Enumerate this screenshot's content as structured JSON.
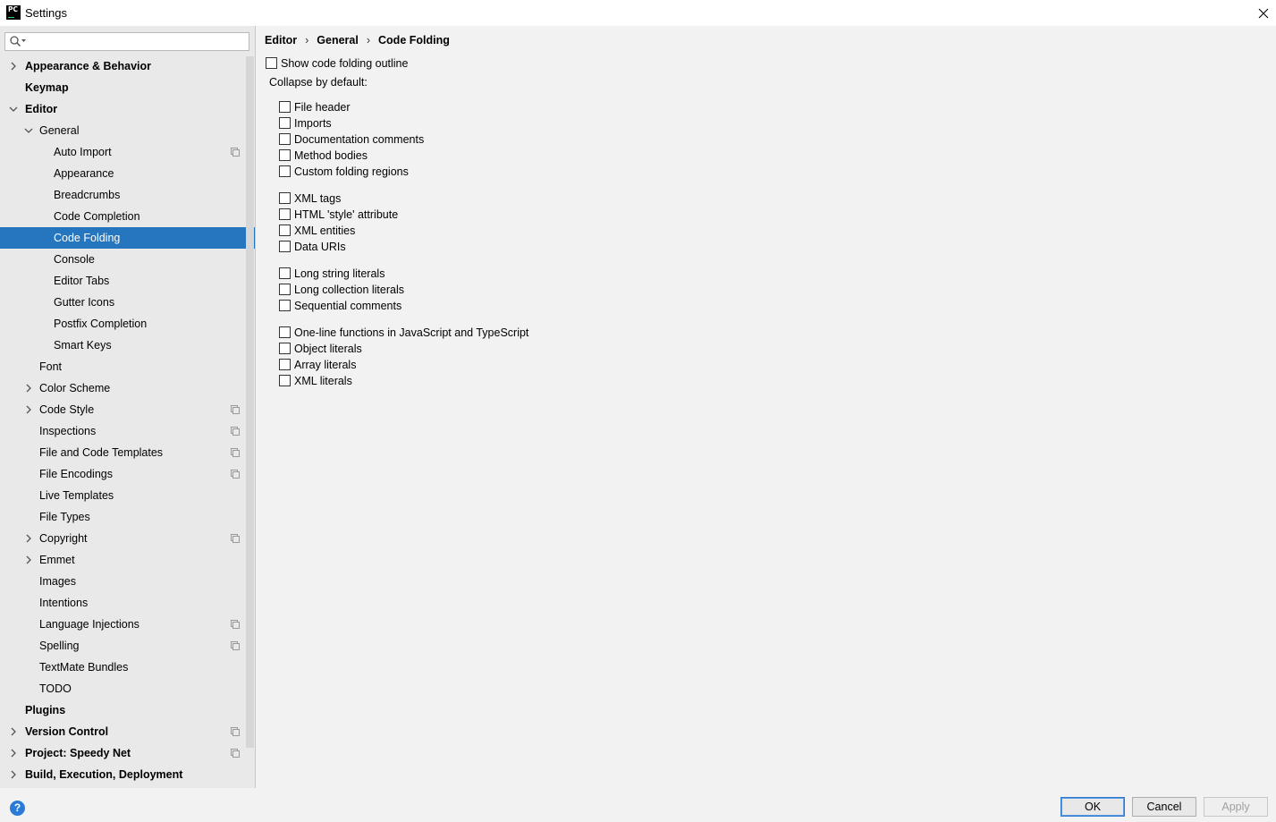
{
  "window": {
    "title": "Settings",
    "app_icon_text": "PC"
  },
  "sidebar": {
    "search_placeholder": "",
    "items": [
      {
        "label": "Appearance & Behavior",
        "level": 0,
        "bold": true,
        "arrow": "right",
        "project": false,
        "selected": false
      },
      {
        "label": "Keymap",
        "level": 0,
        "bold": true,
        "arrow": "none",
        "project": false,
        "selected": false
      },
      {
        "label": "Editor",
        "level": 0,
        "bold": true,
        "arrow": "down",
        "project": false,
        "selected": false
      },
      {
        "label": "General",
        "level": 1,
        "bold": false,
        "arrow": "down",
        "project": false,
        "selected": false
      },
      {
        "label": "Auto Import",
        "level": 2,
        "bold": false,
        "arrow": "none",
        "project": true,
        "selected": false
      },
      {
        "label": "Appearance",
        "level": 2,
        "bold": false,
        "arrow": "none",
        "project": false,
        "selected": false
      },
      {
        "label": "Breadcrumbs",
        "level": 2,
        "bold": false,
        "arrow": "none",
        "project": false,
        "selected": false
      },
      {
        "label": "Code Completion",
        "level": 2,
        "bold": false,
        "arrow": "none",
        "project": false,
        "selected": false
      },
      {
        "label": "Code Folding",
        "level": 2,
        "bold": false,
        "arrow": "none",
        "project": false,
        "selected": true
      },
      {
        "label": "Console",
        "level": 2,
        "bold": false,
        "arrow": "none",
        "project": false,
        "selected": false
      },
      {
        "label": "Editor Tabs",
        "level": 2,
        "bold": false,
        "arrow": "none",
        "project": false,
        "selected": false
      },
      {
        "label": "Gutter Icons",
        "level": 2,
        "bold": false,
        "arrow": "none",
        "project": false,
        "selected": false
      },
      {
        "label": "Postfix Completion",
        "level": 2,
        "bold": false,
        "arrow": "none",
        "project": false,
        "selected": false
      },
      {
        "label": "Smart Keys",
        "level": 2,
        "bold": false,
        "arrow": "none",
        "project": false,
        "selected": false
      },
      {
        "label": "Font",
        "level": 1,
        "bold": false,
        "arrow": "none",
        "project": false,
        "selected": false
      },
      {
        "label": "Color Scheme",
        "level": 1,
        "bold": false,
        "arrow": "right",
        "project": false,
        "selected": false
      },
      {
        "label": "Code Style",
        "level": 1,
        "bold": false,
        "arrow": "right",
        "project": true,
        "selected": false
      },
      {
        "label": "Inspections",
        "level": 1,
        "bold": false,
        "arrow": "none",
        "project": true,
        "selected": false
      },
      {
        "label": "File and Code Templates",
        "level": 1,
        "bold": false,
        "arrow": "none",
        "project": true,
        "selected": false
      },
      {
        "label": "File Encodings",
        "level": 1,
        "bold": false,
        "arrow": "none",
        "project": true,
        "selected": false
      },
      {
        "label": "Live Templates",
        "level": 1,
        "bold": false,
        "arrow": "none",
        "project": false,
        "selected": false
      },
      {
        "label": "File Types",
        "level": 1,
        "bold": false,
        "arrow": "none",
        "project": false,
        "selected": false
      },
      {
        "label": "Copyright",
        "level": 1,
        "bold": false,
        "arrow": "right",
        "project": true,
        "selected": false
      },
      {
        "label": "Emmet",
        "level": 1,
        "bold": false,
        "arrow": "right",
        "project": false,
        "selected": false
      },
      {
        "label": "Images",
        "level": 1,
        "bold": false,
        "arrow": "none",
        "project": false,
        "selected": false
      },
      {
        "label": "Intentions",
        "level": 1,
        "bold": false,
        "arrow": "none",
        "project": false,
        "selected": false
      },
      {
        "label": "Language Injections",
        "level": 1,
        "bold": false,
        "arrow": "none",
        "project": true,
        "selected": false
      },
      {
        "label": "Spelling",
        "level": 1,
        "bold": false,
        "arrow": "none",
        "project": true,
        "selected": false
      },
      {
        "label": "TextMate Bundles",
        "level": 1,
        "bold": false,
        "arrow": "none",
        "project": false,
        "selected": false
      },
      {
        "label": "TODO",
        "level": 1,
        "bold": false,
        "arrow": "none",
        "project": false,
        "selected": false
      },
      {
        "label": "Plugins",
        "level": 0,
        "bold": true,
        "arrow": "none",
        "project": false,
        "selected": false
      },
      {
        "label": "Version Control",
        "level": 0,
        "bold": true,
        "arrow": "right",
        "project": true,
        "selected": false
      },
      {
        "label": "Project: Speedy Net",
        "level": 0,
        "bold": true,
        "arrow": "right",
        "project": true,
        "selected": false
      },
      {
        "label": "Build, Execution, Deployment",
        "level": 0,
        "bold": true,
        "arrow": "right",
        "project": false,
        "selected": false
      }
    ]
  },
  "breadcrumb": {
    "items": [
      "Editor",
      "General",
      "Code Folding"
    ],
    "separator": "›"
  },
  "options": {
    "show_outline": {
      "label": "Show code folding outline",
      "checked": false
    },
    "collapse_label": "Collapse by default:",
    "groups": [
      [
        {
          "label": "File header",
          "checked": false
        },
        {
          "label": "Imports",
          "checked": false
        },
        {
          "label": "Documentation comments",
          "checked": false
        },
        {
          "label": "Method bodies",
          "checked": false
        },
        {
          "label": "Custom folding regions",
          "checked": false
        }
      ],
      [
        {
          "label": "XML tags",
          "checked": false
        },
        {
          "label": "HTML 'style' attribute",
          "checked": false
        },
        {
          "label": "XML entities",
          "checked": false
        },
        {
          "label": "Data URIs",
          "checked": false
        }
      ],
      [
        {
          "label": "Long string literals",
          "checked": false
        },
        {
          "label": "Long collection literals",
          "checked": false
        },
        {
          "label": "Sequential comments",
          "checked": false
        }
      ],
      [
        {
          "label": "One-line functions in JavaScript and TypeScript",
          "checked": false
        },
        {
          "label": "Object literals",
          "checked": false
        },
        {
          "label": "Array literals",
          "checked": false
        },
        {
          "label": "XML literals",
          "checked": false
        }
      ]
    ]
  },
  "buttons": {
    "ok": "OK",
    "cancel": "Cancel",
    "apply": "Apply",
    "help": "?"
  },
  "colors": {
    "selection": "#2675bf",
    "sidebar_bg": "#e9e9e9",
    "content_bg": "#f2f2f2",
    "help_blue": "#2a7bd6"
  }
}
